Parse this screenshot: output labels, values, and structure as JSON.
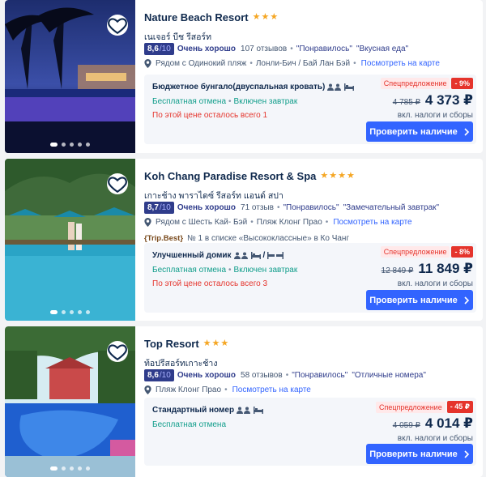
{
  "hotels": [
    {
      "name": "Nature Beach Resort",
      "stars": 3,
      "native_name": "เนเจอร์ บีช รีสอร์ท",
      "score": "8,6",
      "score_den": "/10",
      "verdict": "Очень хорошо",
      "reviews": "107 отзывов",
      "tags": [
        "\"Понравилось\"",
        "\"Вкусная еда\""
      ],
      "location": "Рядом с Одинокий пляж",
      "area": "Лонли-Бич / Бай Лан Бэй",
      "map_link": "Посмотреть на карте",
      "award": null,
      "room_name": "Бюджетное бунгало(двуспальная кровать)",
      "benefits": [
        "Бесплатная отмена",
        "Включен завтрак"
      ],
      "scarcity": "По этой цене осталось всего 1",
      "deal_label": "Спецпредложение",
      "deal_pct": "- 9%",
      "old_price": "4 785 ₽",
      "new_price": "4 373 ₽",
      "tax_note": "вкл. налоги и сборы",
      "button": "Проверить наличие"
    },
    {
      "name": "Koh Chang Paradise Resort & Spa",
      "stars": 4,
      "native_name": "เกาะช้าง พาราไดซ์ รีสอร์ท แอนด์ สปา",
      "score": "8,7",
      "score_den": "/10",
      "verdict": "Очень хорошо",
      "reviews": "71 отзыв",
      "tags": [
        "\"Понравилось\"",
        "\"Замечательный завтрак\""
      ],
      "location": "Рядом с Шесть Кай- Бэй",
      "area": "Пляж Клонг Прао",
      "map_link": "Посмотреть на карте",
      "award": {
        "badge": "{Trip.Best}",
        "text": "№ 1 в списке «Высококлассные» в Ко Чанг"
      },
      "room_name": "Улучшенный домик",
      "benefits": [
        "Бесплатная отмена",
        "Включен завтрак"
      ],
      "scarcity": "По этой цене осталось всего 3",
      "deal_label": "Спецпредложение",
      "deal_pct": "- 8%",
      "old_price": "12 849 ₽",
      "new_price": "11 849 ₽",
      "tax_note": "вкл. налоги и сборы",
      "button": "Проверить наличие"
    },
    {
      "name": "Top Resort",
      "stars": 3,
      "native_name": "ท้อปรีสอร์ทเกาะช้าง",
      "score": "8,6",
      "score_den": "/10",
      "verdict": "Очень хорошо",
      "reviews": "58 отзывов",
      "tags": [
        "\"Понравилось\"",
        "\"Отличные номера\""
      ],
      "location": "Пляж Клонг Прао",
      "area": "",
      "map_link": "Посмотреть на карте",
      "award": null,
      "room_name": "Стандартный номер",
      "benefits": [
        "Бесплатная отмена"
      ],
      "scarcity": "",
      "deal_label": "Спецпредложение",
      "deal_pct": "- 45 ₽",
      "old_price": "4 059 ₽",
      "new_price": "4 014 ₽",
      "tax_note": "вкл. налоги и сборы",
      "button": "Проверить наличие"
    }
  ],
  "icons": {
    "heart": "heart-outline-icon",
    "pin": "location-pin-icon",
    "chevron": "chevron-right-icon",
    "guests": "guests-icon",
    "bed": "bed-icon"
  },
  "colors": {
    "primary": "#3264ff",
    "score_bg": "#2f3c8b",
    "star": "#f5a623",
    "benefit": "#0f9d8a",
    "alert": "#e5342c"
  }
}
